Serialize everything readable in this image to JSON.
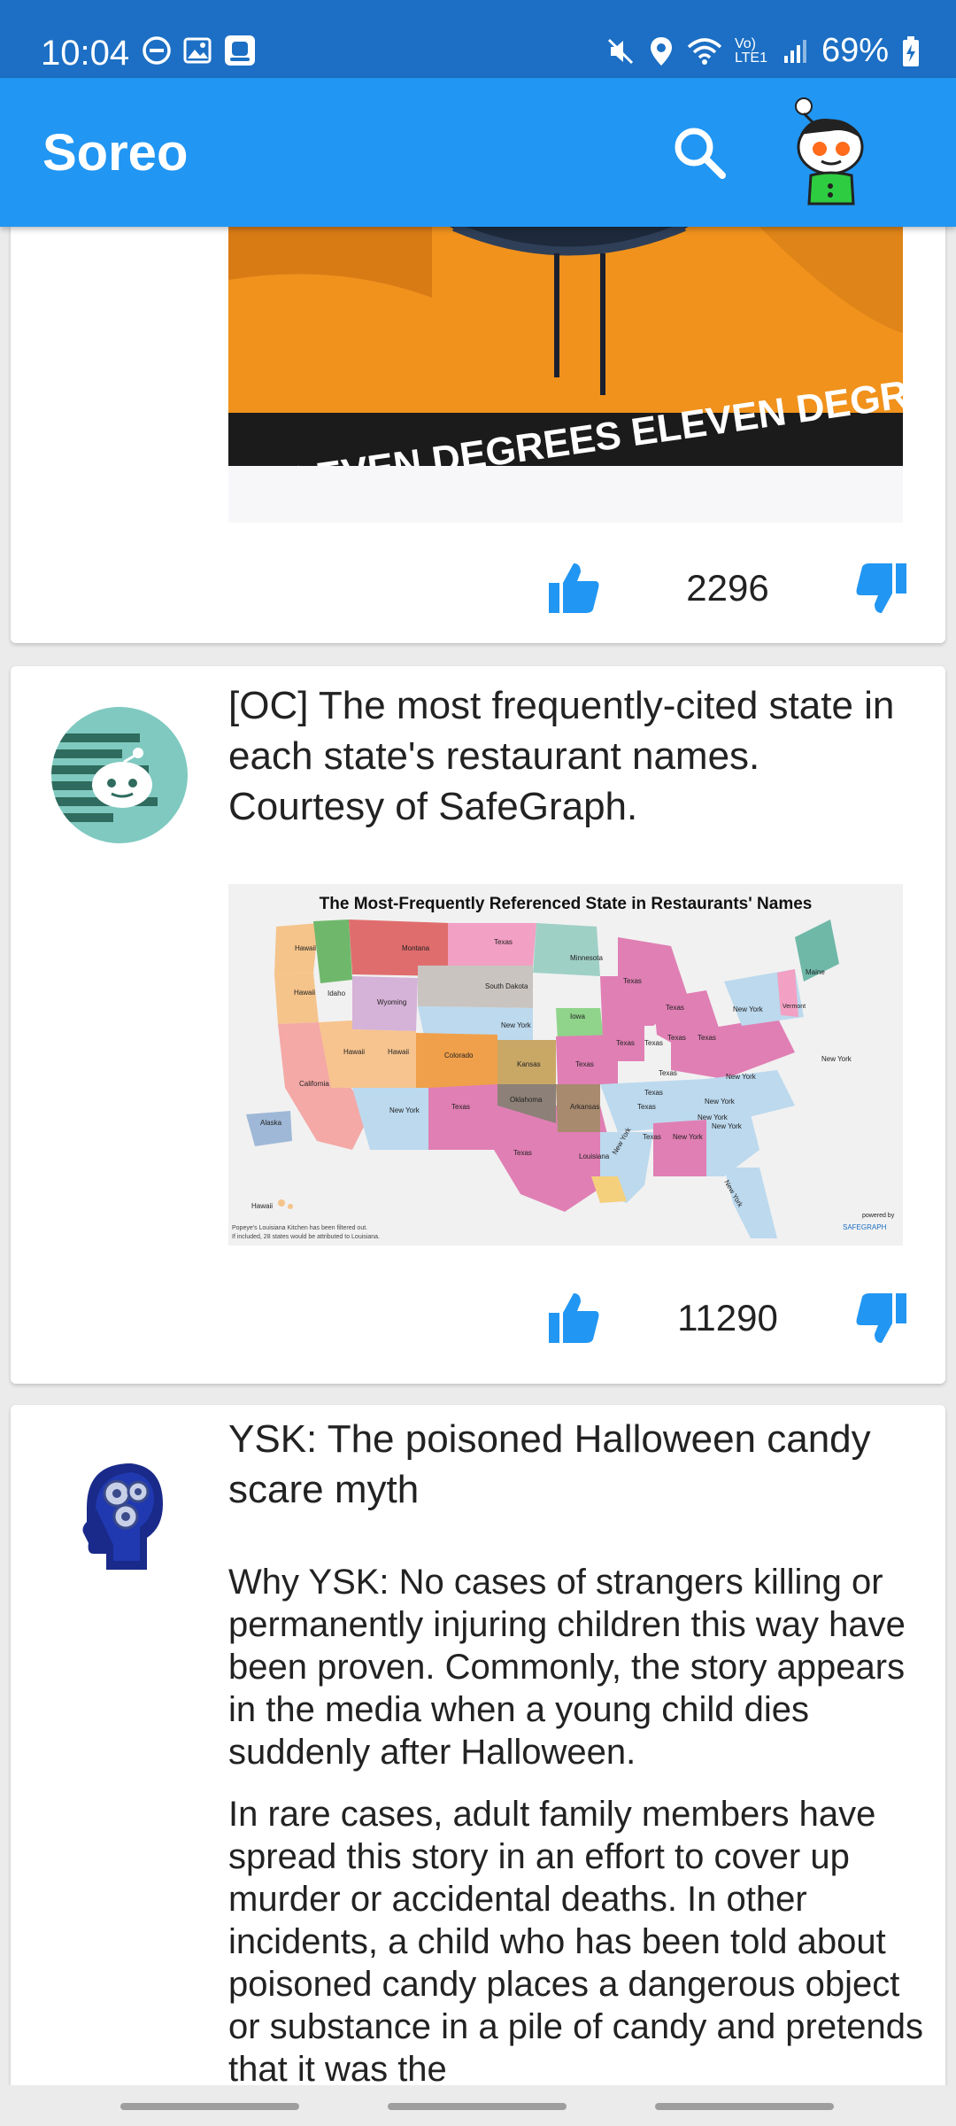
{
  "status_bar": {
    "time": "10:04",
    "network": "Vo) LTE1",
    "battery": "69%"
  },
  "app_bar": {
    "title": "Soreo",
    "search_icon": "search-icon",
    "avatar_icon": "reddit-snoo-avatar"
  },
  "posts": [
    {
      "score": "2296",
      "image_caption": "ELEVEN DEGREES ELEVEN DEGREES"
    },
    {
      "title": "[OC] The most frequently-cited state in each state's restaurant names. Courtesy of SafeGraph.",
      "score": "11290",
      "map": {
        "title": "The Most-Frequently Referenced State in Restaurants' Names",
        "footnote_1": "Popeye's Louisiana Kitchen has been filtered out.",
        "footnote_2": "If included, 28 states would be attributed to Louisiana.",
        "powered_by": "powered by",
        "brand": "SAFEGRAPH",
        "labels": [
          "Hawaii",
          "Hawaii",
          "Montana",
          "Texas",
          "Minnesota",
          "Idaho",
          "Wyoming",
          "South Dakota",
          "Texas",
          "Maine",
          "Texas",
          "New York",
          "Vermont",
          "Texas",
          "New York",
          "Iowa",
          "Hawaii",
          "Hawaii",
          "Colorado",
          "Texas",
          "Texas",
          "Texas",
          "Texas",
          "New York",
          "California",
          "Kansas",
          "Texas",
          "Texas",
          "New York",
          "New York",
          "Oklahoma",
          "Arkansas",
          "Texas",
          "New York",
          "New York",
          "Texas",
          "Texas",
          "New York",
          "New York",
          "Alaska",
          "Texas",
          "Louisiana",
          "New York",
          "Hawaii",
          "New York"
        ]
      }
    },
    {
      "title": "YSK: The poisoned Halloween candy scare myth",
      "paragraphs": [
        "Why YSK: No cases of strangers killing or permanently injuring children this way have been proven. Commonly, the story appears in the media when a young child dies suddenly after Halloween.",
        "In rare cases, adult family members have spread this story in an effort to cover up murder or accidental deaths. In other incidents, a child who has been told about poisoned candy places a dangerous object or substance in a pile of candy and pretends that it was the"
      ]
    }
  ],
  "colors": {
    "status_bar": "#1c6fc4",
    "app_bar": "#2196f3",
    "vote": "#2196f3"
  }
}
